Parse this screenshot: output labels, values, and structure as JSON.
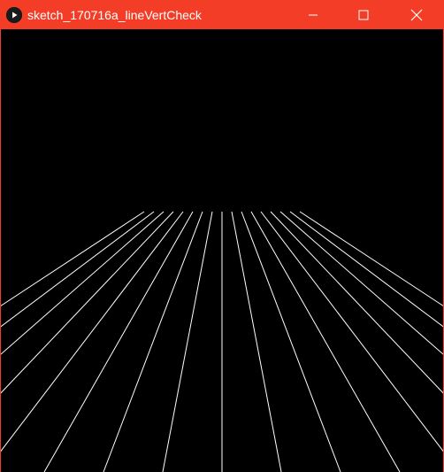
{
  "window": {
    "title": "sketch_170716a_lineVertCheck",
    "accent_color": "#f33d26",
    "icons": {
      "app": "play-icon",
      "minimize": "minimize-icon",
      "maximize": "maximize-icon",
      "close": "close-icon"
    }
  },
  "sketch": {
    "background_color": "#000000",
    "line_color": "#ffffff",
    "line_count": 17
  }
}
